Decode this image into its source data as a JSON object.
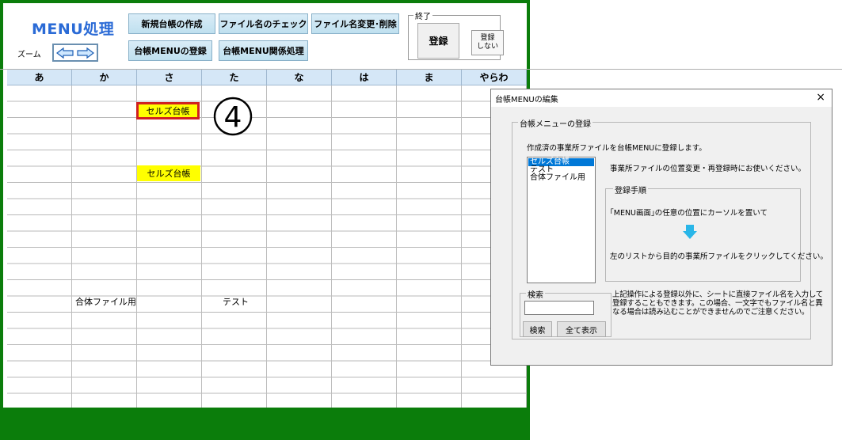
{
  "toolbar": {
    "title": "MENU処理",
    "zoom_label": "ズーム",
    "zoom_icon": "double-arrow-icon",
    "buttons": {
      "new_ledger": "新規台帳の作成",
      "check_filename": "ファイル名のチェック",
      "rename_delete": "ファイル名変更･削除",
      "register_menu": "台帳MENUの登録",
      "menu_related": "台帳MENU関係処理"
    },
    "end_group": {
      "label": "終了",
      "register": "登録",
      "no_register": "登録\nしない"
    }
  },
  "sheet": {
    "columns": [
      "あ",
      "か",
      "さ",
      "た",
      "な",
      "は",
      "ま",
      "やらわ"
    ],
    "cells": {
      "sa_row2": "セルズ台帳",
      "sa_row6": "セルズ台帳",
      "ka_row16": "合体ファイル用",
      "ta_row16": "テスト"
    },
    "step_number": "④"
  },
  "dialog": {
    "title": "台帳MENUの編集",
    "close": "×",
    "group_label": "台帳メニューの登録",
    "intro": "作成済の事業所ファイルを台帳MENUに登録します。",
    "list_items": [
      "セルズ台帳",
      "テスト",
      "合体ファイル用"
    ],
    "selected_index": 0,
    "hint": "事業所ファイルの位置変更・再登録時にお使いください。",
    "steps_label": "登録手順",
    "step1": "｢MENU画面｣の任意の位置にカーソルを置いて",
    "step2": "左のリストから目的の事業所ファイルをクリックしてください。",
    "search_label": "検索",
    "search_value": "",
    "search_button": "検索",
    "show_all_button": "全て表示",
    "note": "上記操作による登録以外に、シートに直接ファイル名を入力して登録することもできます。この場合、一文字でもファイル名と異なる場合は読み込むことができませんのでご注意ください。"
  },
  "colors": {
    "frame_green": "#0b7d0b",
    "title_blue": "#2b6bd6",
    "highlight_yellow": "#ffff00",
    "selection_red": "#d02020",
    "arrow_cyan": "#29b6e8"
  }
}
